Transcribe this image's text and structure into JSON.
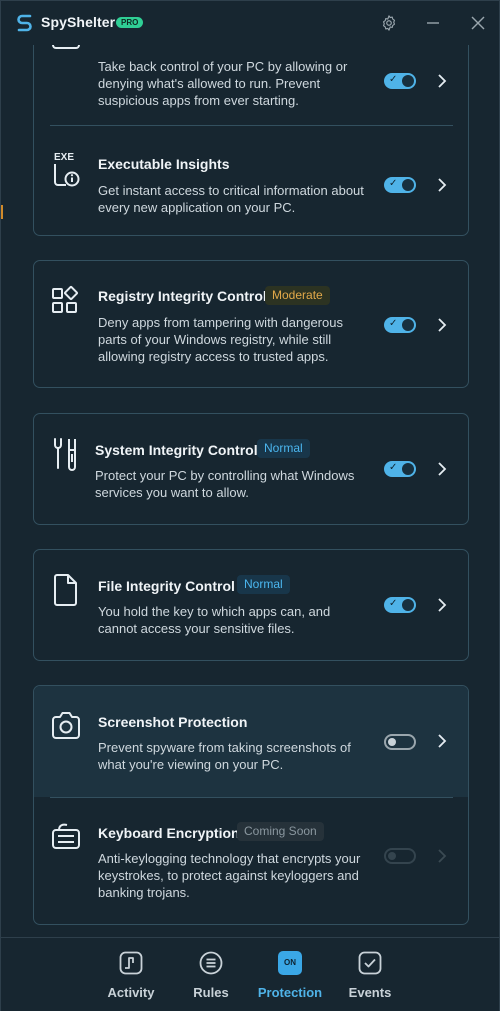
{
  "app": {
    "name": "SpyShelter",
    "badge": "PRO"
  },
  "features": [
    {
      "title": "",
      "desc": "Take back control of your PC by allowing or denying what's allowed to run. Prevent suspicious apps from ever starting.",
      "enabled": true,
      "icon": "window-icon"
    },
    {
      "title": "Executable Insights",
      "desc": "Get instant access to critical information about every new application on your PC.",
      "enabled": true,
      "icon": "exe-info-icon",
      "icon_text": "EXE"
    },
    {
      "title": "Registry Integrity Control",
      "badge": "Moderate",
      "desc": "Deny apps from tampering with dangerous parts of your Windows registry, while still allowing registry access to trusted apps.",
      "enabled": true,
      "icon": "registry-blocks-icon"
    },
    {
      "title": "System Integrity Control",
      "badge": "Normal",
      "desc": "Protect your PC by controlling what Windows services you want to allow.",
      "enabled": true,
      "icon": "tools-icon"
    },
    {
      "title": "File Integrity Control",
      "badge": "Normal",
      "desc": "You hold the key to which apps can, and cannot access your sensitive files.",
      "enabled": true,
      "icon": "file-icon"
    },
    {
      "title": "Screenshot Protection",
      "desc": "Prevent spyware from taking screenshots of what you're viewing on your PC.",
      "enabled": false,
      "icon": "camera-icon"
    },
    {
      "title": "Keyboard Encryption",
      "badge": "Coming Soon",
      "desc": "Anti-keylogging technology that encrypts your keystrokes, to protect against keyloggers and banking trojans.",
      "enabled": false,
      "disabled": true,
      "icon": "keyboard-icon"
    }
  ],
  "toggle_check": "✓",
  "nav": [
    {
      "label": "Activity",
      "icon": "activity-icon"
    },
    {
      "label": "Rules",
      "icon": "rules-icon"
    },
    {
      "label": "Protection",
      "icon": "protection-icon",
      "pill": "ON",
      "active": true
    },
    {
      "label": "Events",
      "icon": "events-icon"
    }
  ],
  "colors": {
    "accent": "#4fb3e8",
    "moderate": "#e2a94a",
    "normal": "#4bb6ef",
    "pro": "#2fcf95"
  }
}
